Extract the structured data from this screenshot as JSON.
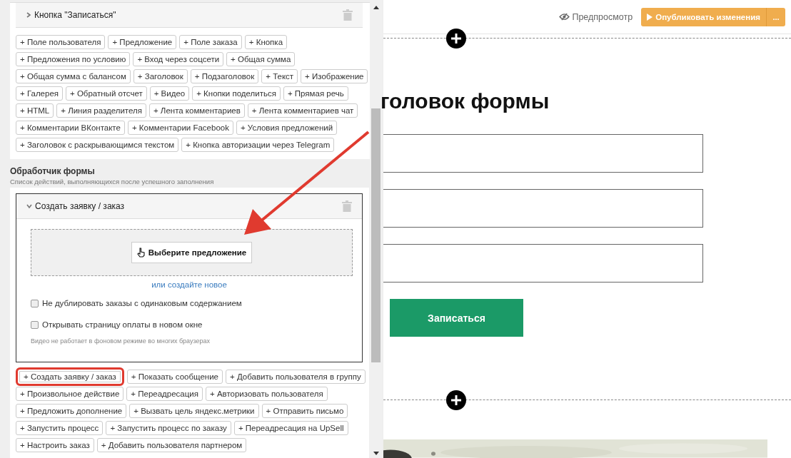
{
  "element_block": {
    "title": "Кнопка \"Записаться\"",
    "expanded": false
  },
  "element_buttons": [
    {
      "items": [
        "+ Поле пользователя",
        "+ Предложение",
        "+ Поле заказа",
        "+ Кнопка"
      ]
    },
    {
      "items": [
        "+ Предложения по условию",
        "+ Вход через соцсети",
        "+ Общая сумма"
      ]
    },
    {
      "items": [
        "+ Общая сумма с балансом",
        "+ Заголовок",
        "+ Подзаголовок",
        "+ Текст",
        "+ Изображение"
      ]
    },
    {
      "items": [
        "+ Галерея",
        "+ Обратный отсчет",
        "+ Видео",
        "+ Кнопки поделиться",
        "+ Прямая речь"
      ]
    },
    {
      "items": [
        "+ HTML",
        "+ Линия разделителя",
        "+ Лента комментариев",
        "+ Лента комментариев чат"
      ]
    },
    {
      "items": [
        "+ Комментарии ВКонтакте",
        "+ Комментарии Facebook",
        "+ Условия предложений"
      ]
    },
    {
      "items": [
        "+ Заголовок с раскрывающимся текстом",
        "+ Кнопка авторизации через Telegram"
      ]
    }
  ],
  "handler": {
    "title": "Обработчик формы",
    "subtitle": "Список действий, выполняющихся после успешного заполнения",
    "action": {
      "title": "Создать заявку / заказ",
      "expanded": true,
      "offer_button": "Выберите предложение",
      "create_link": "или создайте новое",
      "options": [
        {
          "label": "Не дублировать заказы с одинаковым содержанием",
          "checked": false
        },
        {
          "label": "Открывать страницу оплаты в новом окне",
          "checked": false
        }
      ],
      "note": "Видео не работает в фоновом режиме во многих браузерах"
    }
  },
  "action_buttons": [
    {
      "items": [
        {
          "label": "+ Создать заявку / заказ",
          "highlighted": true
        },
        {
          "label": "+ Показать сообщение",
          "highlighted": false
        },
        {
          "label": "+ Добавить пользователя в группу",
          "highlighted": false
        }
      ]
    },
    {
      "items": [
        {
          "label": "+ Произвольное действие",
          "highlighted": false
        },
        {
          "label": "+ Переадресация",
          "highlighted": false
        },
        {
          "label": "+ Авторизовать пользователя",
          "highlighted": false
        }
      ]
    },
    {
      "items": [
        {
          "label": "+ Предложить дополнение",
          "highlighted": false
        },
        {
          "label": "+ Вызвать цель яндекс.метрики",
          "highlighted": false
        },
        {
          "label": "+ Отправить письмо",
          "highlighted": false
        }
      ]
    },
    {
      "items": [
        {
          "label": "+ Запустить процесс",
          "highlighted": false
        },
        {
          "label": "+ Запустить процесс по заказу",
          "highlighted": false
        },
        {
          "label": "+ Переадресация на UpSell",
          "highlighted": false
        }
      ]
    },
    {
      "items": [
        {
          "label": "+ Настроить заказ",
          "highlighted": false
        },
        {
          "label": "+ Добавить пользователя партнером",
          "highlighted": false
        }
      ]
    }
  ],
  "toolbar": {
    "preview": "Предпросмотр",
    "publish": "Опубликовать изменения",
    "more": "..."
  },
  "canvas": {
    "heading": "головок формы",
    "fields": [
      {
        "kind": "text"
      },
      {
        "kind": "text"
      },
      {
        "kind": "text"
      }
    ],
    "submit": "Записаться"
  }
}
